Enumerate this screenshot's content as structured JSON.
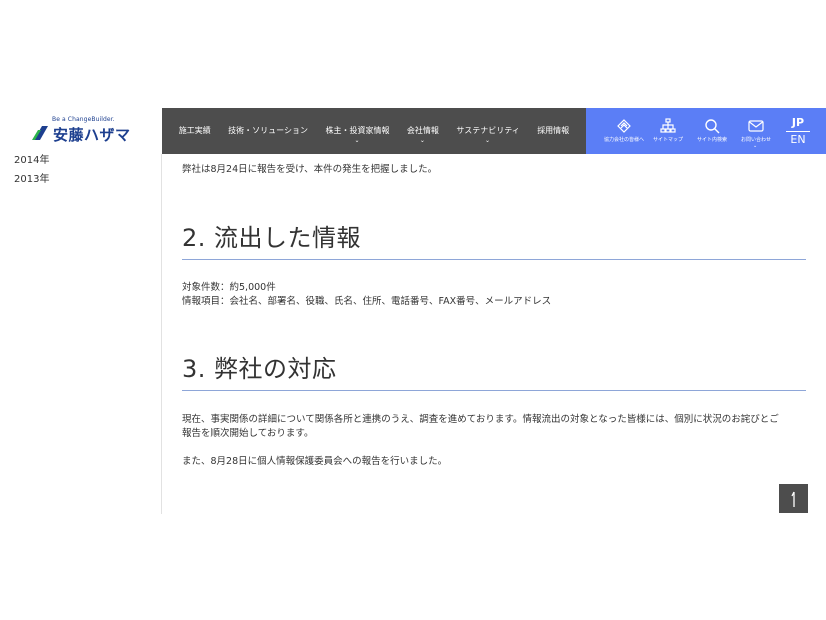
{
  "logo": {
    "tagline": "Be a ChangeBuilder.",
    "name": "安藤ハザマ",
    "colors": {
      "navy": "#1d3f8f",
      "green": "#2bb34a"
    }
  },
  "nav": {
    "items": [
      {
        "label": "施工実績",
        "has_dropdown": false
      },
      {
        "label": "技術・ソリューション",
        "has_dropdown": false
      },
      {
        "label": "株主・投資家情報",
        "has_dropdown": true
      },
      {
        "label": "会社情報",
        "has_dropdown": true
      },
      {
        "label": "サステナビリティ",
        "has_dropdown": true
      },
      {
        "label": "採用情報",
        "has_dropdown": false
      }
    ],
    "background": "#4d4d4d"
  },
  "utility": {
    "background": "#5b7ef6",
    "items": [
      {
        "icon": "handshake-icon",
        "label": "協力会社の皆様へ"
      },
      {
        "icon": "sitemap-icon",
        "label": "サイトマップ"
      },
      {
        "icon": "search-icon",
        "label": "サイト内検索"
      },
      {
        "icon": "mail-icon",
        "label": "お問い合わせ"
      }
    ],
    "lang": {
      "jp": "JP",
      "en": "EN"
    }
  },
  "sidebar": {
    "years": [
      "2014年",
      "2013年"
    ]
  },
  "content": {
    "intro": "弊社は8月24日に報告を受け、本件の発生を把握しました。",
    "section2": {
      "heading": "2. 流出した情報",
      "lines": [
        "対象件数：約5,000件",
        "情報項目：会社名、部署名、役職、氏名、住所、電話番号、FAX番号、メールアドレス"
      ]
    },
    "section3": {
      "heading": "3. 弊社の対応",
      "para1_line1": "現在、事実関係の詳細について関係各所と連携のうえ、調査を進めております。情報流出の対象となった皆様には、個別に状況のお詫びとご",
      "para1_line2": "報告を順次開始しております。",
      "para2": "また、8月28日に個人情報保護委員会への報告を行いました。"
    }
  },
  "back_to_top": {
    "icon": "arrow-up-icon"
  }
}
